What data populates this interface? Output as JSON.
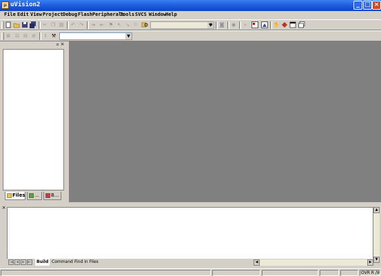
{
  "window": {
    "title": "uVision2",
    "minimize_label": "_",
    "maximize_label": "□",
    "close_label": "×"
  },
  "menu": {
    "items": [
      "File",
      "Edit",
      "View",
      "Project",
      "Debug",
      "Flash",
      "Peripherals",
      "Tools",
      "SVCS",
      "Window",
      "Help"
    ]
  },
  "toolbar1": {
    "icons": [
      "new-file-icon",
      "open-folder-icon",
      "save-icon",
      "save-all-icon",
      "cut-icon",
      "copy-icon",
      "paste-icon",
      "undo-icon",
      "redo-icon",
      "indent-icon",
      "unindent-icon",
      "bookmark-toggle-icon",
      "bookmark-prev-icon",
      "bookmark-next-icon",
      "bookmark-clear-icon",
      "find-in-files-icon",
      "find-icon",
      "debug-start-icon",
      "breakpoint-icon",
      "workbook-mode-icon",
      "options-icon",
      "stop-icon",
      "help-icon",
      "window-icon"
    ],
    "find_combo_value": ""
  },
  "toolbar2": {
    "icons": [
      "translate-icon",
      "build-target-icon",
      "rebuild-all-icon",
      "stop-build-icon",
      "download-icon",
      "target-options-icon"
    ],
    "target_combo_value": ""
  },
  "workspace": {
    "tabs": [
      {
        "label": "Files",
        "icon": "files-tab-icon"
      },
      {
        "label": "...",
        "icon": "regs-tab-icon"
      },
      {
        "label": "B...",
        "icon": "books-tab-icon"
      }
    ]
  },
  "output": {
    "tabs": [
      "Build",
      "Command",
      "Find in Files"
    ],
    "active_tab": "Build"
  },
  "status": {
    "mode": "OVR R /W"
  }
}
